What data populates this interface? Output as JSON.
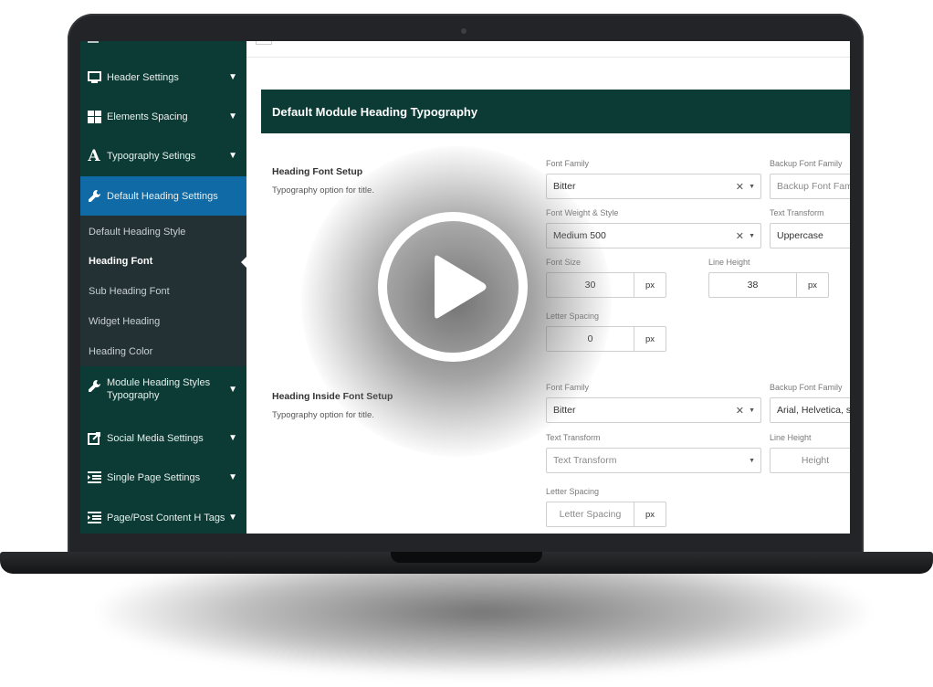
{
  "sidebar": {
    "items": [
      {
        "label": "Header Settings",
        "icon": "monitor-icon"
      },
      {
        "label": "Elements Spacing",
        "icon": "grid-icon"
      },
      {
        "label": "Typography Setings",
        "icon": "typography-icon"
      },
      {
        "label": "Default Heading Settings",
        "icon": "wrench-icon"
      },
      {
        "label": "Module Heading Styles Typography",
        "icon": "wrench-icon"
      },
      {
        "label": "Social Media Settings",
        "icon": "share-icon"
      },
      {
        "label": "Single Page Settings",
        "icon": "list-icon"
      },
      {
        "label": "Page/Post Content H Tags",
        "icon": "list-icon"
      }
    ],
    "submenu": [
      "Default Heading Style",
      "Heading Font",
      "Sub Heading Font",
      "Widget Heading",
      "Heading Color"
    ],
    "active_color": "#0f6aa6",
    "bg_color": "#0b3b34"
  },
  "main": {
    "banner_title": "Default Module Heading Typography",
    "section1": {
      "title": "Heading Font Setup",
      "desc": "Typography option for title.",
      "font_family_label": "Font Family",
      "font_family_value": "Bitter",
      "backup_label": "Backup Font Family",
      "backup_placeholder": "Backup Font Family",
      "weight_label": "Font Weight & Style",
      "weight_value": "Medium 500",
      "transform_label": "Text Transform",
      "transform_value": "Uppercase",
      "size_label": "Font Size",
      "size_value": "30",
      "size_unit": "px",
      "lineheight_label": "Line Height",
      "lineheight_value": "38",
      "lineheight_unit": "px",
      "spacing_label": "Letter Spacing",
      "spacing_value": "0",
      "spacing_unit": "px"
    },
    "section2": {
      "title": "Heading Inside Font Setup",
      "desc": "Typography option for title.",
      "font_family_label": "Font Family",
      "font_family_value": "Bitter",
      "backup_label": "Backup Font Family",
      "backup_value": "Arial, Helvetica, sans-serif",
      "transform_label": "Text Transform",
      "transform_placeholder": "Text Transform",
      "lineheight_label": "Line Height",
      "lineheight_placeholder": "Height",
      "spacing_label": "Letter Spacing",
      "spacing_placeholder": "Letter Spacing",
      "spacing_unit": "px"
    }
  },
  "overlay": {
    "icon": "play-icon"
  }
}
